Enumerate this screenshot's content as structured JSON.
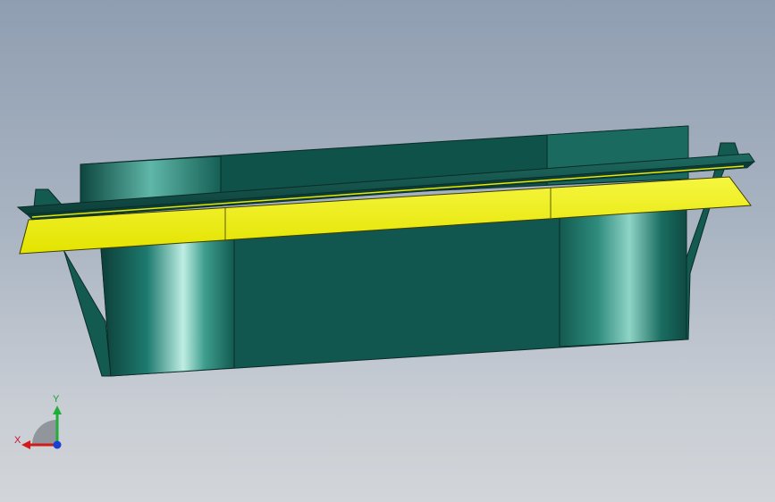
{
  "viewport": {
    "background_top": "#8f9eb1",
    "background_bottom": "#d2d5d9"
  },
  "model": {
    "body_color": "#11574f",
    "flange_color": "#f2f200",
    "edge_color": "#0b2b27"
  },
  "triad": {
    "x_label": "X",
    "y_label": "Y",
    "x_color": "#d11b1b",
    "y_color": "#1fae3a",
    "z_color": "#1b3fd1",
    "plane_color": "#8a8f96"
  }
}
